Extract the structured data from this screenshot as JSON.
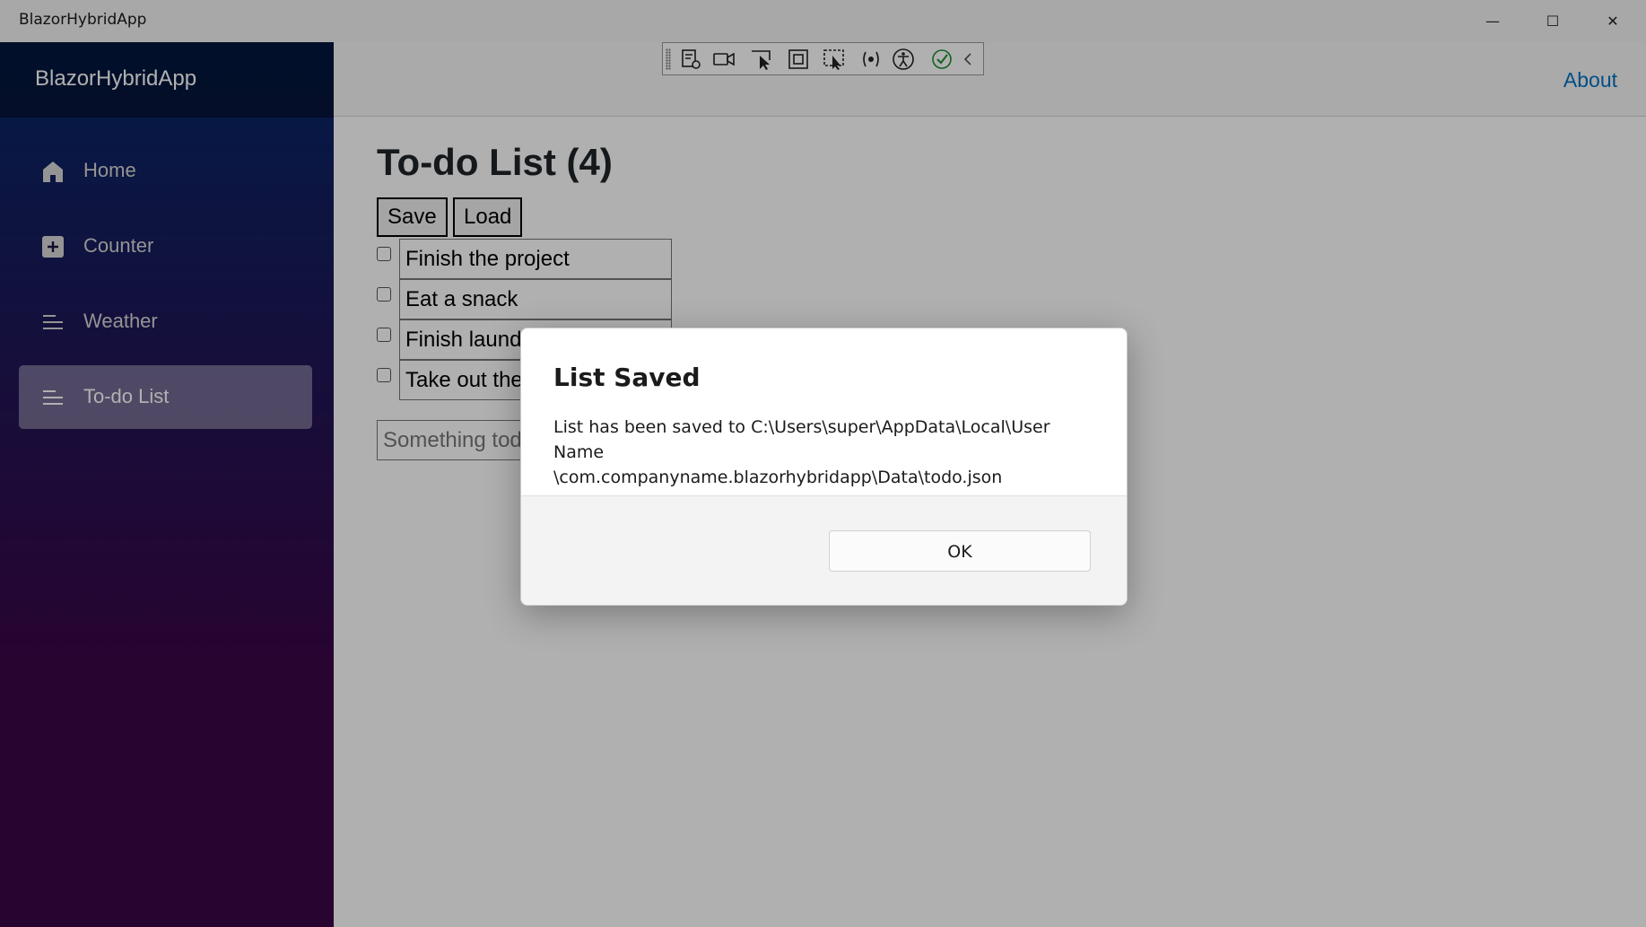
{
  "window": {
    "title": "BlazorHybridApp",
    "minimize": "—",
    "maximize": "☐",
    "close": "✕"
  },
  "sidebar": {
    "brand": "BlazorHybridApp",
    "items": [
      {
        "label": "Home",
        "icon": "home-icon"
      },
      {
        "label": "Counter",
        "icon": "plus-square-icon"
      },
      {
        "label": "Weather",
        "icon": "list-icon"
      },
      {
        "label": "To-do List",
        "icon": "list-icon",
        "active": true
      }
    ]
  },
  "header": {
    "about": "About"
  },
  "devtools": {
    "tools": [
      "live-visual-tree-icon",
      "video-icon",
      "select-element-icon",
      "display-layout-adorners-icon",
      "track-focus-icon",
      "hot-reload-icon",
      "accessibility-icon",
      "check-icon",
      "collapse-chevron-icon"
    ]
  },
  "todo": {
    "title": "To-do List (4)",
    "save": "Save",
    "load": "Load",
    "items": [
      "Finish the project",
      "Eat a snack",
      "Finish laundry",
      "Take out the trash"
    ],
    "new_placeholder": "Something todo"
  },
  "dialog": {
    "title": "List Saved",
    "message_line1": "List has been saved to C:\\Users\\super\\AppData\\Local\\User Name",
    "message_line2": "\\com.companyname.blazorhybridapp\\Data\\todo.json",
    "ok": "OK"
  },
  "colors": {
    "accent": "#0071c1",
    "sidebar_top": "#052767",
    "sidebar_bottom": "#3a0647"
  }
}
